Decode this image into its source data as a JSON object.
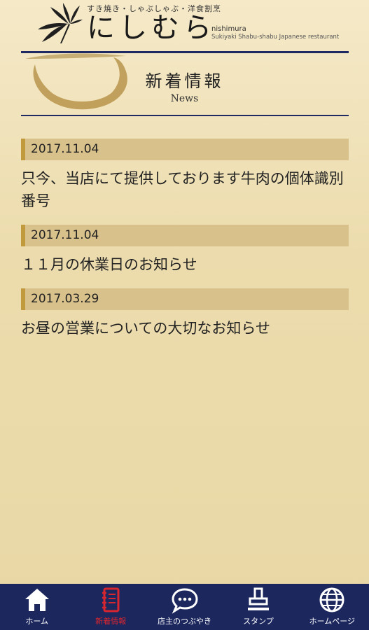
{
  "header": {
    "tagline": "すき焼き・しゃぶしゃぶ・洋食割烹",
    "brand": "にしむら",
    "brand_roman": "nishimura",
    "brand_sub": "Sukiyaki Shabu-shabu Japanese restaurant"
  },
  "section": {
    "title": "新着情報",
    "subtitle": "News"
  },
  "news": [
    {
      "date": "2017.11.04",
      "title": "只今、当店にて提供しております牛肉の個体識別番号"
    },
    {
      "date": "2017.11.04",
      "title": "１１月の休業日のお知らせ"
    },
    {
      "date": "2017.03.29",
      "title": "お昼の営業についての大切なお知らせ"
    }
  ],
  "nav": {
    "items": [
      {
        "label": "ホーム",
        "icon": "home-icon"
      },
      {
        "label": "新着情報",
        "icon": "notebook-icon",
        "active": true
      },
      {
        "label": "店主のつぶやき",
        "icon": "chat-bubble-icon"
      },
      {
        "label": "スタンプ",
        "icon": "stamp-icon"
      },
      {
        "label": "ホームページ",
        "icon": "globe-icon"
      }
    ]
  },
  "colors": {
    "accent_navy": "#1c275e",
    "active_red": "#d8262e",
    "date_bar": "#d8c18b",
    "date_mark": "#c19a3e"
  }
}
